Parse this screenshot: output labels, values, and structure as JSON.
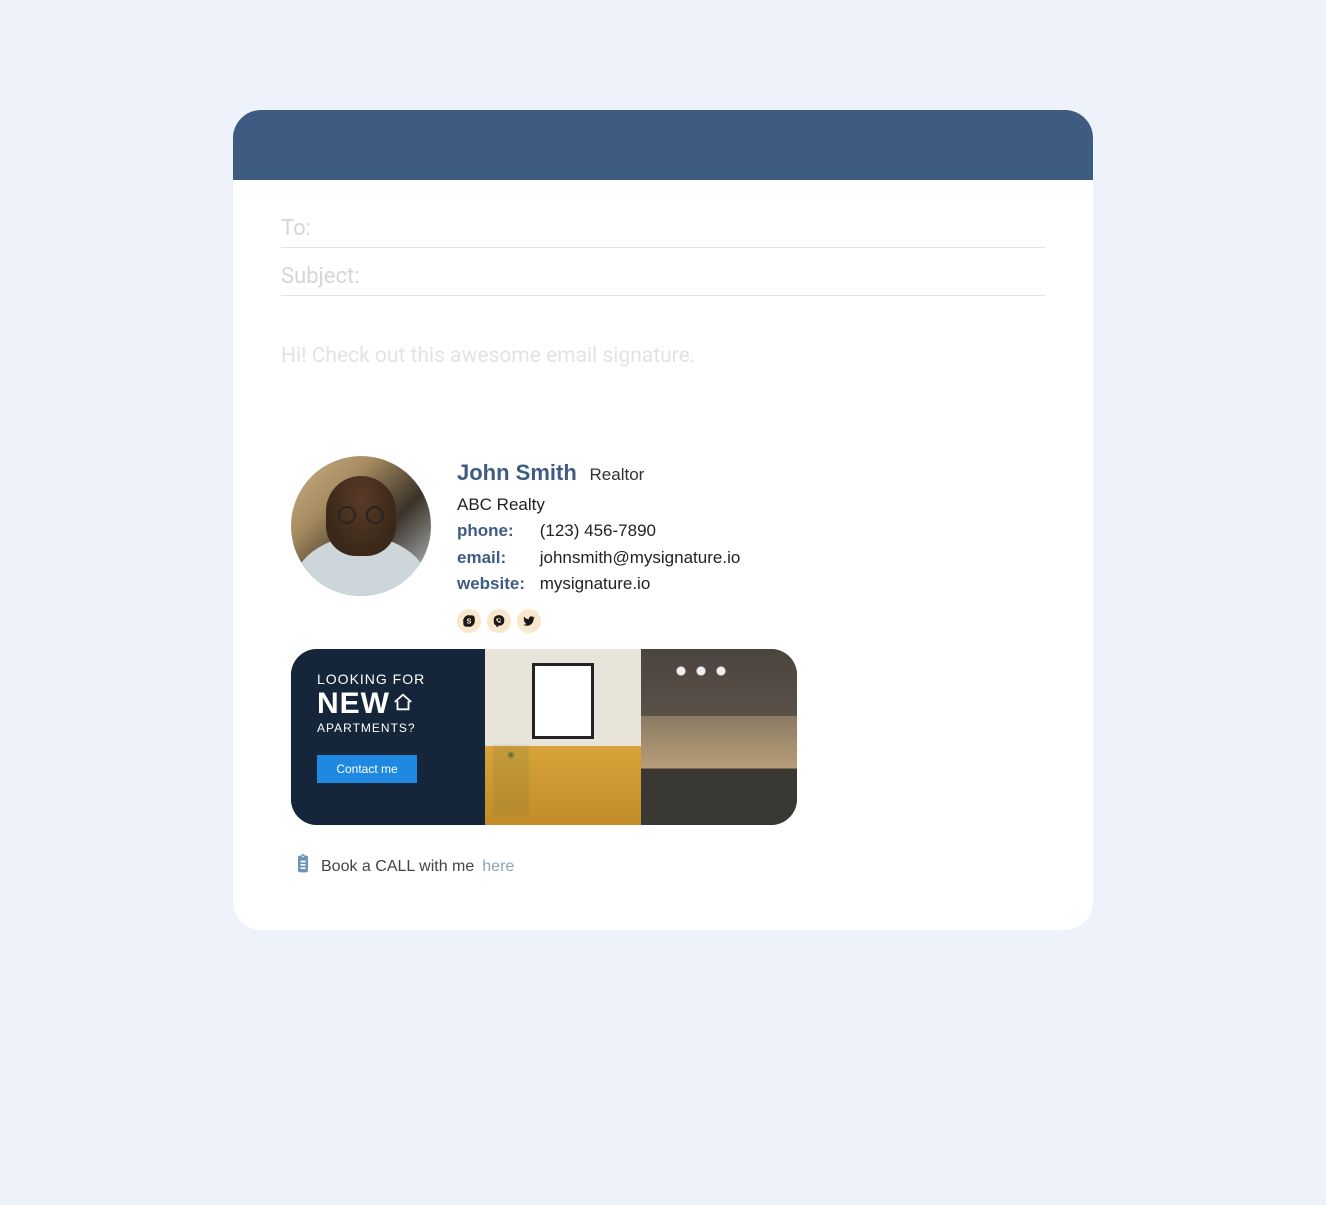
{
  "fields": {
    "to_label": "To:",
    "subject_label": "Subject:"
  },
  "body_text": "Hi! Check out this awesome email signature.",
  "signature": {
    "name": "John Smith",
    "title": "Realtor",
    "company": "ABC Realty",
    "phone_label": "phone:",
    "phone": "(123) 456-7890",
    "email_label": "email:",
    "email": "johnsmith@mysignature.io",
    "website_label": "website:",
    "website": "mysignature.io"
  },
  "social": {
    "skype": "skype",
    "viber": "viber",
    "twitter": "twitter"
  },
  "banner": {
    "line1": "LOOKING FOR",
    "line2": "NEW",
    "line3": "APARTMENTS?",
    "button": "Contact me"
  },
  "book": {
    "text": "Book a CALL with me",
    "link": "here"
  },
  "colors": {
    "header_bar": "#3e5c82",
    "accent": "#3e5c82",
    "banner_bg": "#15263b",
    "banner_btn": "#1f88e0"
  }
}
